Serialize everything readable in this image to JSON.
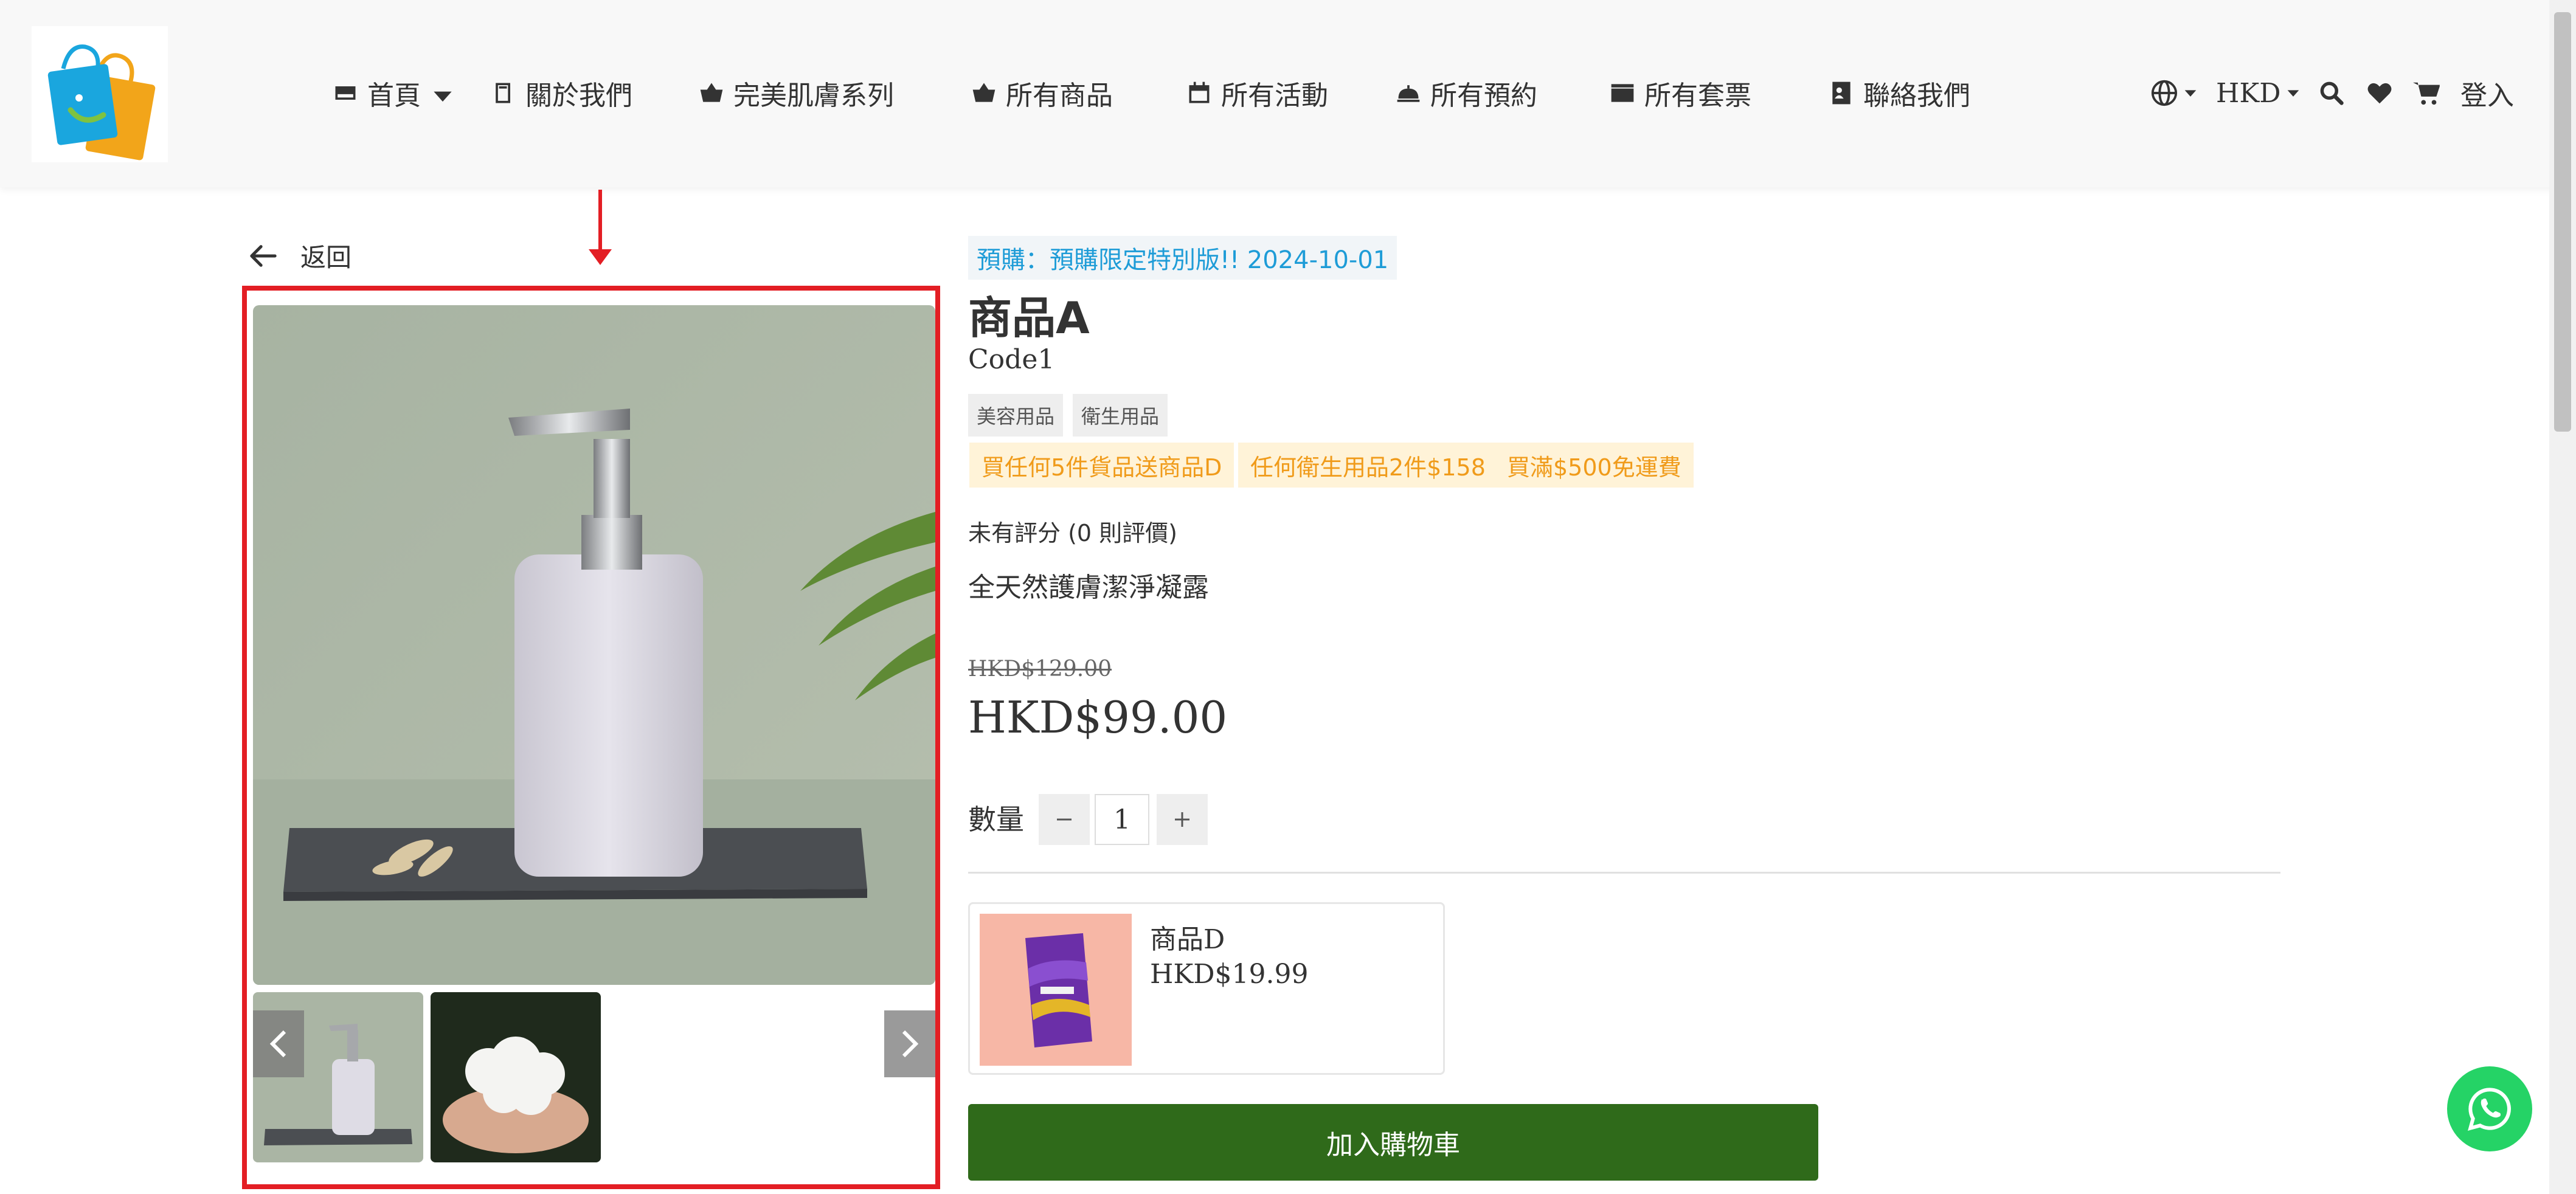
{
  "header": {
    "nav": [
      {
        "label": "首頁",
        "icon": "hdd-icon",
        "has_dropdown": true
      },
      {
        "label": "關於我們",
        "icon": "book-icon"
      },
      {
        "label": "完美肌膚系列",
        "icon": "basket-icon"
      },
      {
        "label": "所有商品",
        "icon": "basket-icon"
      },
      {
        "label": "所有活動",
        "icon": "calendar-icon"
      },
      {
        "label": "所有預約",
        "icon": "bell-icon"
      },
      {
        "label": "所有套票",
        "icon": "ticket-icon"
      },
      {
        "label": "聯絡我們",
        "icon": "contact-card-icon"
      }
    ],
    "currency": "HKD",
    "login": "登入"
  },
  "back_label": "返回",
  "product": {
    "preorder_badge": "預購：預購限定特別版!! 2024-10-01",
    "title": "商品A",
    "code": "Code1",
    "tags": [
      "美容用品",
      "衛生用品"
    ],
    "promotions": [
      "買任何5件貨品送商品D",
      "任何衛生用品2件$158",
      "買滿$500免運費"
    ],
    "rating_text": "未有評分 (0 則評價)",
    "description": "全天然護膚潔淨凝露",
    "original_price": "HKD$129.00",
    "price": "HKD$99.00",
    "quantity_label": "數量",
    "quantity": "1"
  },
  "gift": {
    "name": "商品D",
    "price": "HKD$19.99"
  },
  "add_to_cart": "加入購物車",
  "colors": {
    "accent_green": "#2f6a1a",
    "preorder_blue": "#1e9cd7",
    "promo_orange": "#f09b1a",
    "annotation_red": "#e31e24",
    "whatsapp_green": "#25d366"
  }
}
